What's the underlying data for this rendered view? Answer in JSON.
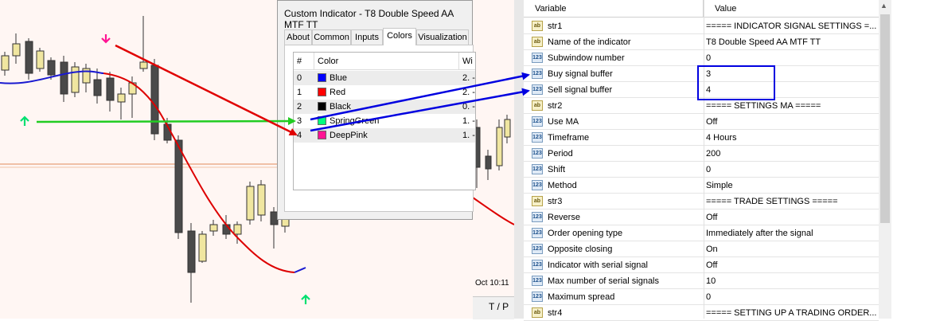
{
  "dialog": {
    "title": "Custom Indicator - T8 Double Speed AA MTF TT",
    "tabs": [
      {
        "label": "About",
        "active": false
      },
      {
        "label": "Common",
        "active": false
      },
      {
        "label": "Inputs",
        "active": false
      },
      {
        "label": "Colors",
        "active": true
      },
      {
        "label": "Visualization",
        "active": false
      }
    ],
    "colors_table": {
      "headers": [
        "#",
        "Color",
        "Wi"
      ],
      "rows": [
        {
          "index": "0",
          "name": "Blue",
          "swatch": "#0000ff",
          "width": "2. -"
        },
        {
          "index": "1",
          "name": "Red",
          "swatch": "#ff0000",
          "width": "2. -"
        },
        {
          "index": "2",
          "name": "Black",
          "swatch": "#000000",
          "width": "0. -"
        },
        {
          "index": "3",
          "name": "SpringGreen",
          "swatch": "#00ff7f",
          "width": "1. -"
        },
        {
          "index": "4",
          "name": "DeepPink",
          "swatch": "#ff1493",
          "width": "1. -"
        }
      ]
    }
  },
  "chart": {
    "background": "#fff6f3",
    "bull_candle": "#f0e6a0",
    "bear_candle": "#4a4a4a",
    "ma_blue": "#1a1ad0",
    "ma_red": "#dd0000",
    "buy_arrow": "#00e070",
    "sell_arrow": "#ff1493"
  },
  "mid_panel": {
    "date_label": "Oct 10:11",
    "bottom_label": "T / P"
  },
  "properties": {
    "headers": {
      "variable": "Variable",
      "value": "Value"
    },
    "rows": [
      {
        "icon": "ab",
        "variable": "str1",
        "value": "===== INDICATOR SIGNAL SETTINGS =..."
      },
      {
        "icon": "ab",
        "variable": "Name of the indicator",
        "value": "T8 Double Speed AA MTF TT"
      },
      {
        "icon": "123",
        "variable": "Subwindow number",
        "value": "0"
      },
      {
        "icon": "123",
        "variable": "Buy signal buffer",
        "value": "3"
      },
      {
        "icon": "123",
        "variable": "Sell signal buffer",
        "value": "4"
      },
      {
        "icon": "ab",
        "variable": "str2",
        "value": "===== SETTINGS MA ====="
      },
      {
        "icon": "123",
        "variable": "Use MA",
        "value": "Off"
      },
      {
        "icon": "123",
        "variable": "Timeframe",
        "value": "4 Hours"
      },
      {
        "icon": "123",
        "variable": "Period",
        "value": "200"
      },
      {
        "icon": "123",
        "variable": "Shift",
        "value": "0"
      },
      {
        "icon": "123",
        "variable": "Method",
        "value": "Simple"
      },
      {
        "icon": "ab",
        "variable": "str3",
        "value": "===== TRADE SETTINGS ====="
      },
      {
        "icon": "123",
        "variable": "Reverse",
        "value": "Off"
      },
      {
        "icon": "123",
        "variable": "Order opening type",
        "value": "Immediately after the signal"
      },
      {
        "icon": "123",
        "variable": "Opposite closing",
        "value": "On"
      },
      {
        "icon": "123",
        "variable": "Indicator with serial signal",
        "value": "Off"
      },
      {
        "icon": "123",
        "variable": "Max number of serial signals",
        "value": "10"
      },
      {
        "icon": "123",
        "variable": "Maximum spread",
        "value": "0"
      },
      {
        "icon": "ab",
        "variable": "str4",
        "value": "===== SETTING UP A TRADING ORDER..."
      }
    ]
  }
}
